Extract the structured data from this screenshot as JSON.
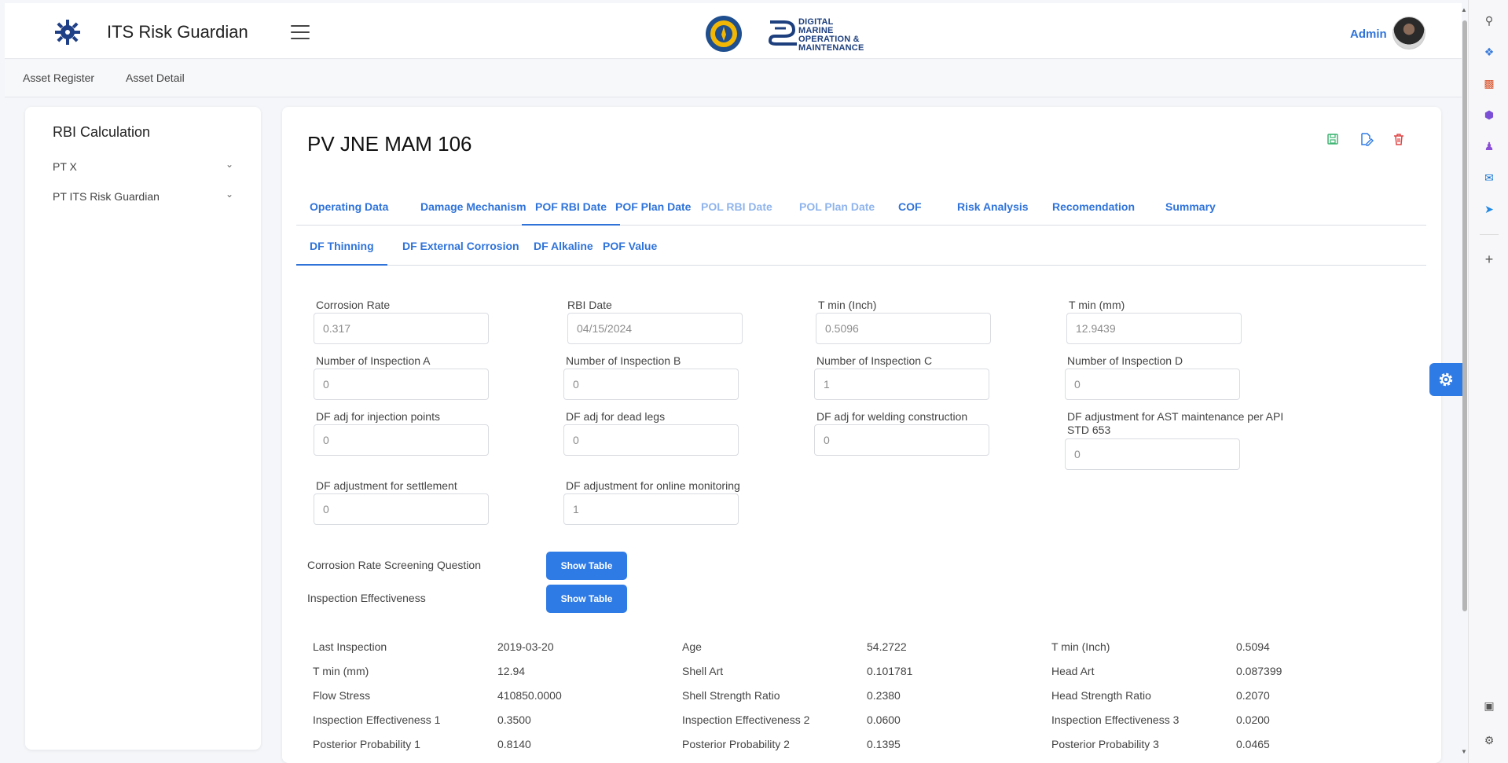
{
  "header": {
    "app_title": "ITS Risk Guardian",
    "brand_lines": [
      "DIGITAL",
      "MARINE",
      "OPERATION &",
      "MAINTENANCE"
    ],
    "user_label": "Admin"
  },
  "breadcrumbs": [
    "Asset Register",
    "Asset Detail"
  ],
  "sidebar": {
    "title": "RBI Calculation",
    "items": [
      {
        "label": "PT X"
      },
      {
        "label": "PT ITS Risk Guardian"
      }
    ]
  },
  "main": {
    "title": "PV JNE MAM 106",
    "actions": [
      "save-icon",
      "edit-icon",
      "delete-icon"
    ],
    "tabs": [
      {
        "label": "Operating Data",
        "state": "normal"
      },
      {
        "label": "Damage Mechanism",
        "state": "normal"
      },
      {
        "label": "POF RBI Date",
        "state": "active"
      },
      {
        "label": "POF Plan Date",
        "state": "normal"
      },
      {
        "label": "POL RBI Date",
        "state": "disabled"
      },
      {
        "label": "POL Plan Date",
        "state": "disabled"
      },
      {
        "label": "COF",
        "state": "normal"
      },
      {
        "label": "Risk Analysis",
        "state": "normal"
      },
      {
        "label": "Recomendation",
        "state": "normal"
      },
      {
        "label": "Summary",
        "state": "normal"
      }
    ],
    "subtabs": [
      {
        "label": "DF Thinning",
        "state": "active"
      },
      {
        "label": "DF External Corrosion",
        "state": "normal"
      },
      {
        "label": "DF Alkaline",
        "state": "normal"
      },
      {
        "label": "POF Value",
        "state": "normal"
      }
    ],
    "fields": [
      {
        "label": "Corrosion Rate",
        "value": "0.317"
      },
      {
        "label": "RBI Date",
        "value": "04/15/2024"
      },
      {
        "label": "T min (Inch)",
        "value": "0.5096"
      },
      {
        "label": "T min (mm)",
        "value": "12.9439"
      },
      {
        "label": "Number of Inspection A",
        "value": "0"
      },
      {
        "label": "Number of Inspection B",
        "value": "0"
      },
      {
        "label": "Number of Inspection C",
        "value": "1"
      },
      {
        "label": "Number of Inspection D",
        "value": "0"
      },
      {
        "label": "DF adj for injection points",
        "value": "0"
      },
      {
        "label": "DF adj for dead legs",
        "value": "0"
      },
      {
        "label": "DF adj for welding construction",
        "value": "0"
      },
      {
        "label": "DF adjustment for AST maintenance per API STD 653",
        "value": "0"
      },
      {
        "label": "DF adjustment for settlement",
        "value": "0"
      },
      {
        "label": "DF adjustment for online monitoring",
        "value": "1"
      }
    ],
    "screening": [
      {
        "label": "Corrosion Rate Screening Question",
        "button": "Show Table"
      },
      {
        "label": "Inspection Effectiveness",
        "button": "Show Table"
      }
    ],
    "results": [
      [
        {
          "k": "Last Inspection",
          "v": "2019-03-20"
        },
        {
          "k": "Age",
          "v": "54.2722"
        },
        {
          "k": "T min (Inch)",
          "v": "0.5094"
        }
      ],
      [
        {
          "k": "T min (mm)",
          "v": "12.94"
        },
        {
          "k": "Shell Art",
          "v": "0.101781"
        },
        {
          "k": "Head Art",
          "v": "0.087399"
        }
      ],
      [
        {
          "k": "Flow Stress",
          "v": "410850.0000"
        },
        {
          "k": "Shell Strength Ratio",
          "v": "0.2380"
        },
        {
          "k": "Head Strength Ratio",
          "v": "0.2070"
        }
      ],
      [
        {
          "k": "Inspection Effectiveness 1",
          "v": "0.3500"
        },
        {
          "k": "Inspection Effectiveness 2",
          "v": "0.0600"
        },
        {
          "k": "Inspection Effectiveness 3",
          "v": "0.0200"
        }
      ],
      [
        {
          "k": "Posterior Probability 1",
          "v": "0.8140"
        },
        {
          "k": "Posterior Probability 2",
          "v": "0.1395"
        },
        {
          "k": "Posterior Probability 3",
          "v": "0.0465"
        }
      ]
    ]
  },
  "rail_icons": [
    "search-icon",
    "tag-icon",
    "briefcase-icon",
    "copilot-icon",
    "games-icon",
    "outlook-icon",
    "send-icon",
    "add-icon",
    "screenshot-icon",
    "settings-icon"
  ],
  "floating": {
    "icon": "gear-icon"
  },
  "colors": {
    "accent": "#2f73d9",
    "button": "#2f7be5",
    "save": "#3cb371",
    "delete": "#e04545"
  }
}
